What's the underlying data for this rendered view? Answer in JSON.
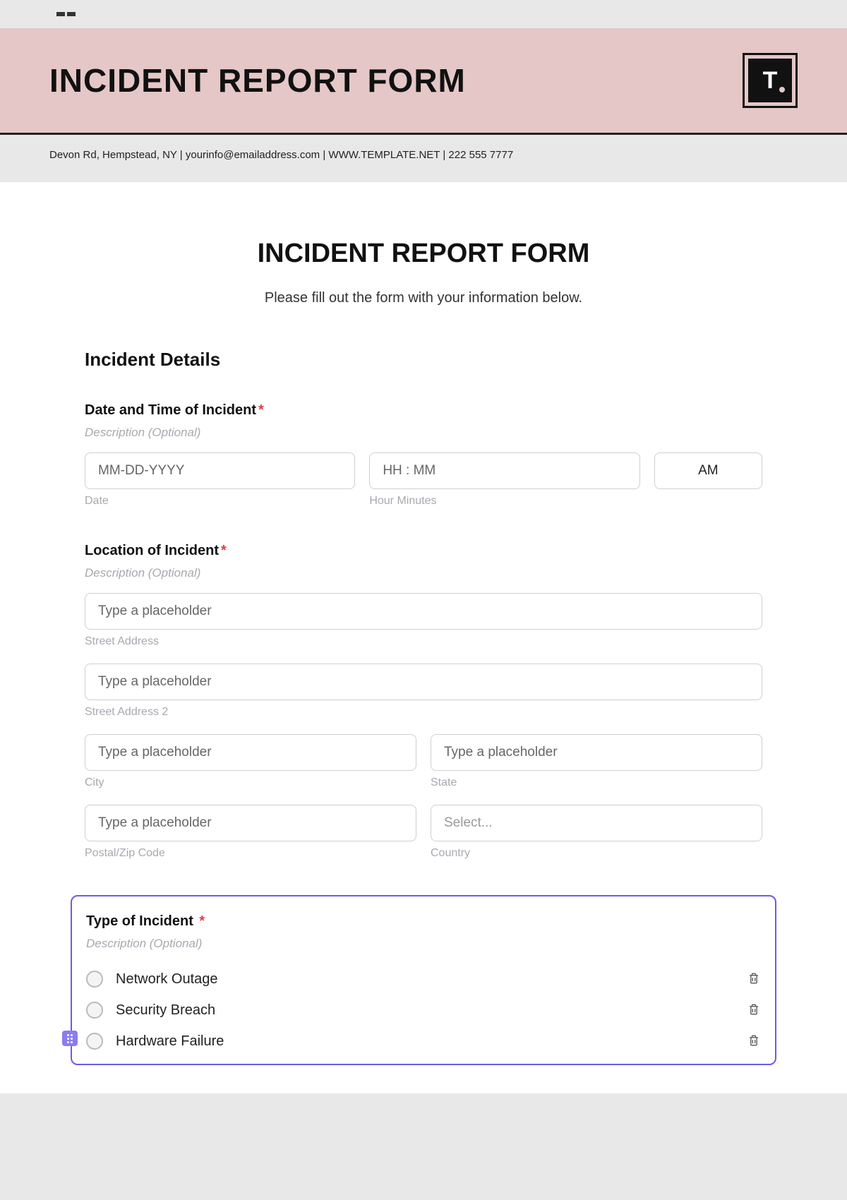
{
  "banner": {
    "title": "INCIDENT REPORT FORM",
    "logo_text": "T",
    "contact_line": "Devon Rd, Hempstead, NY | yourinfo@emailaddress.com | WWW.TEMPLATE.NET | 222 555 7777"
  },
  "form": {
    "title": "INCIDENT REPORT FORM",
    "subtitle": "Please fill out the form with your information below.",
    "section_incident_details": "Incident Details",
    "datetime": {
      "label": "Date and Time of Incident",
      "description": "Description (Optional)",
      "date_placeholder": "MM-DD-YYYY",
      "date_sublabel": "Date",
      "time_placeholder": "HH : MM",
      "time_sublabel": "Hour Minutes",
      "ampm": "AM"
    },
    "location": {
      "label": "Location of Incident",
      "description": "Description (Optional)",
      "street_placeholder": "Type a placeholder",
      "street_sublabel": "Street Address",
      "street2_placeholder": "Type a placeholder",
      "street2_sublabel": "Street Address 2",
      "city_placeholder": "Type a placeholder",
      "city_sublabel": "City",
      "state_placeholder": "Type a placeholder",
      "state_sublabel": "State",
      "postal_placeholder": "Type a placeholder",
      "postal_sublabel": "Postal/Zip Code",
      "country_placeholder": "Select...",
      "country_sublabel": "Country"
    },
    "incident_type": {
      "label": "Type of Incident",
      "description": "Description (Optional)",
      "options": [
        "Network Outage",
        "Security Breach",
        "Hardware Failure"
      ]
    }
  }
}
